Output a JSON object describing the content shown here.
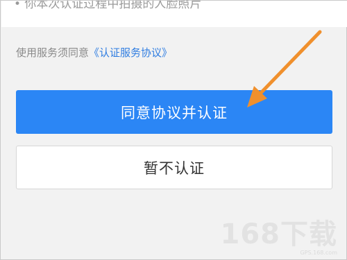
{
  "top_notice": "• 你本次认证过程中拍摄的人脸照片",
  "agreement": {
    "prefix": "使用服务须同意",
    "link": "《认证服务协议》"
  },
  "buttons": {
    "primary_label": "同意协议并认证",
    "secondary_label": "暂不认证"
  },
  "watermark": {
    "main": "168下载",
    "sub": "GPS.168.com"
  },
  "colors": {
    "primary": "#2b86f5",
    "link": "#2f7de1",
    "arrow": "#f0902d"
  }
}
